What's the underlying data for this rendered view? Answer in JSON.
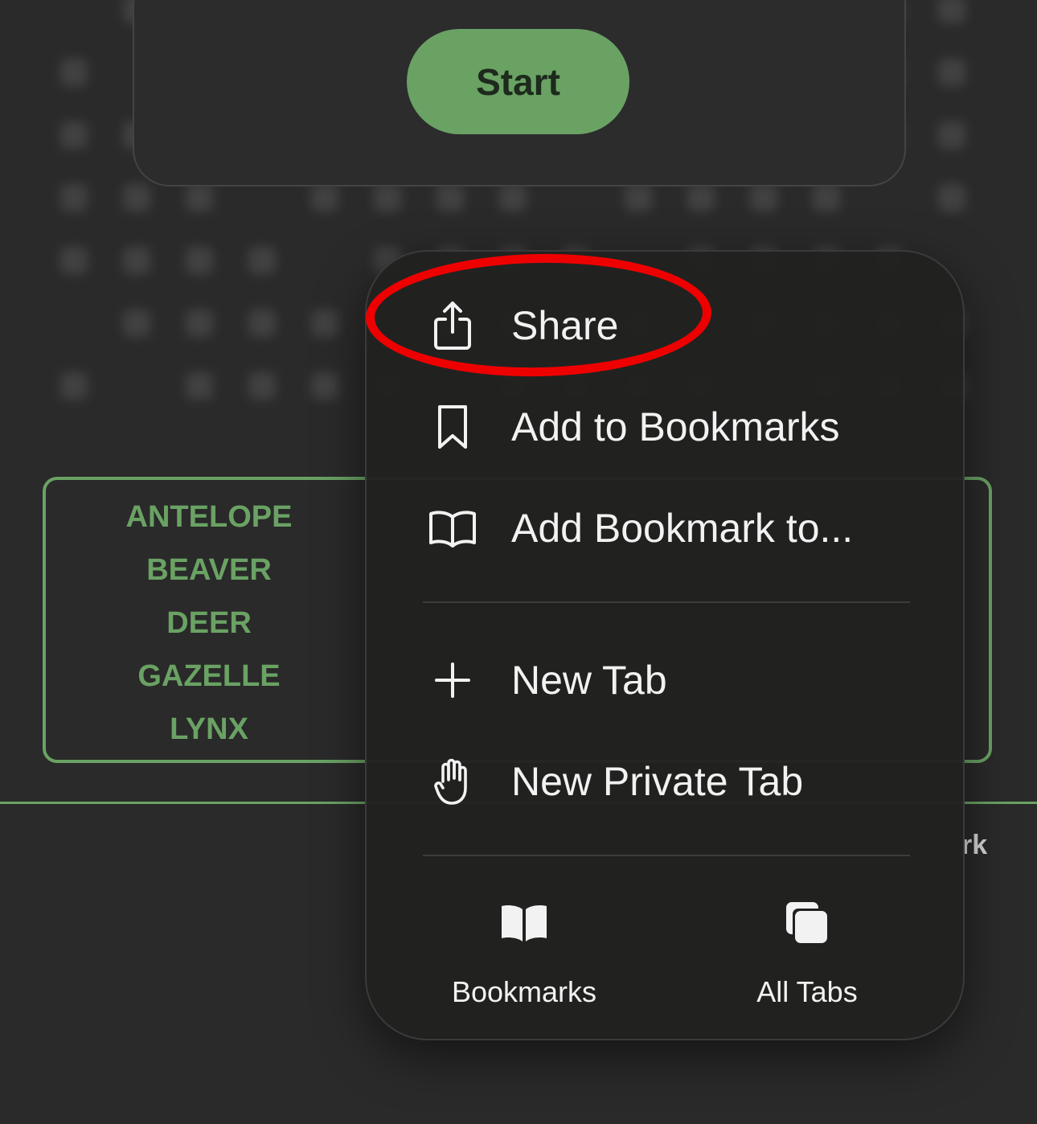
{
  "start_button": {
    "label": "Start"
  },
  "word_list": [
    "ANTELOPE",
    "BEAVER",
    "DEER",
    "GAZELLE",
    "LYNX"
  ],
  "partial_text": "rk",
  "menu": {
    "items": [
      {
        "label": "Share",
        "icon": "share-icon"
      },
      {
        "label": "Add to Bookmarks",
        "icon": "bookmark-icon"
      },
      {
        "label": "Add Bookmark to...",
        "icon": "open-book-icon"
      },
      {
        "label": "New Tab",
        "icon": "plus-icon"
      },
      {
        "label": "New Private Tab",
        "icon": "hand-icon"
      }
    ],
    "bottom": [
      {
        "label": "Bookmarks",
        "icon": "book-icon"
      },
      {
        "label": "All Tabs",
        "icon": "tabs-icon"
      }
    ]
  },
  "colors": {
    "accent": "#6aa264",
    "background": "#2a2a2a",
    "menu_bg": "#212220",
    "highlight": "#ee0000"
  }
}
